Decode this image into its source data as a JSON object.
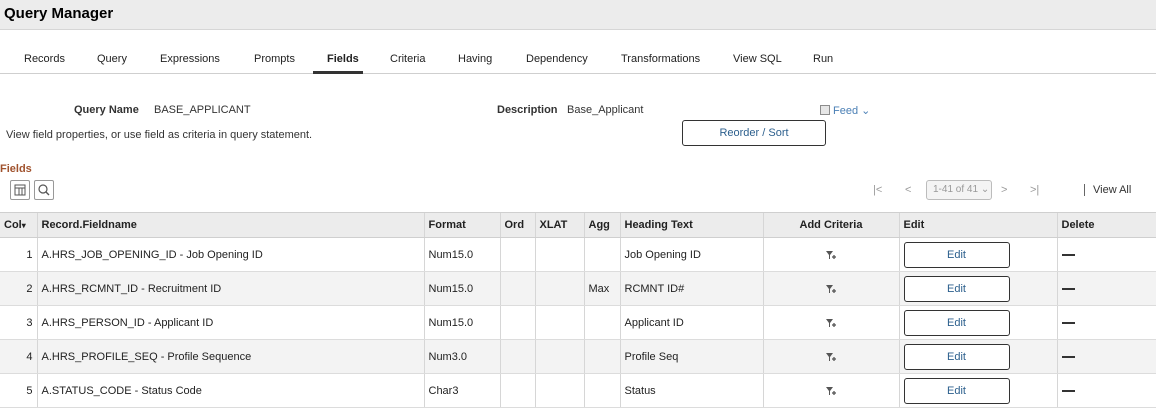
{
  "app": {
    "title": "Query Manager"
  },
  "tabs": [
    {
      "label": "Records"
    },
    {
      "label": "Query"
    },
    {
      "label": "Expressions"
    },
    {
      "label": "Prompts"
    },
    {
      "label": "Fields",
      "active": true
    },
    {
      "label": "Criteria"
    },
    {
      "label": "Having"
    },
    {
      "label": "Dependency"
    },
    {
      "label": "Transformations"
    },
    {
      "label": "View SQL"
    },
    {
      "label": "Run"
    }
  ],
  "query": {
    "name_label": "Query Name",
    "name_value": "BASE_APPLICANT",
    "description_label": "Description",
    "description_value": "Base_Applicant",
    "instructions": "View field properties, or use field as criteria in query statement.",
    "reorder_label": "Reorder / Sort",
    "feed_label": "Feed"
  },
  "fields_section": {
    "title": "Fields",
    "pager_range": "1-41 of 41",
    "view_all": "View All",
    "columns": {
      "col": "Col",
      "record_fieldname": "Record.Fieldname",
      "format": "Format",
      "ord": "Ord",
      "xlat": "XLAT",
      "agg": "Agg",
      "heading_text": "Heading Text",
      "add_criteria": "Add Criteria",
      "edit": "Edit",
      "delete": "Delete"
    },
    "edit_label": "Edit",
    "rows": [
      {
        "col": "1",
        "record_fieldname": "A.HRS_JOB_OPENING_ID - Job Opening ID",
        "format": "Num15.0",
        "ord": "",
        "xlat": "",
        "agg": "",
        "heading_text": "Job Opening ID"
      },
      {
        "col": "2",
        "record_fieldname": "A.HRS_RCMNT_ID - Recruitment ID",
        "format": "Num15.0",
        "ord": "",
        "xlat": "",
        "agg": "Max",
        "heading_text": "RCMNT ID#"
      },
      {
        "col": "3",
        "record_fieldname": "A.HRS_PERSON_ID - Applicant ID",
        "format": "Num15.0",
        "ord": "",
        "xlat": "",
        "agg": "",
        "heading_text": "Applicant ID"
      },
      {
        "col": "4",
        "record_fieldname": "A.HRS_PROFILE_SEQ - Profile Sequence",
        "format": "Num3.0",
        "ord": "",
        "xlat": "",
        "agg": "",
        "heading_text": "Profile Seq"
      },
      {
        "col": "5",
        "record_fieldname": "A.STATUS_CODE - Status Code",
        "format": "Char3",
        "ord": "",
        "xlat": "",
        "agg": "",
        "heading_text": "Status"
      }
    ]
  },
  "icons": {
    "grid_personalize": "grid-personalize-icon",
    "search": "search-icon",
    "add_criteria": "add-criteria-icon",
    "feed": "feed-icon",
    "first": "first-page-icon",
    "prev": "previous-page-icon",
    "next": "next-page-icon",
    "last": "last-page-icon",
    "delete": "delete-icon"
  },
  "colors": {
    "section_title": "#a0522d",
    "link": "#2c5f8d",
    "feed": "#4a7fb5"
  }
}
